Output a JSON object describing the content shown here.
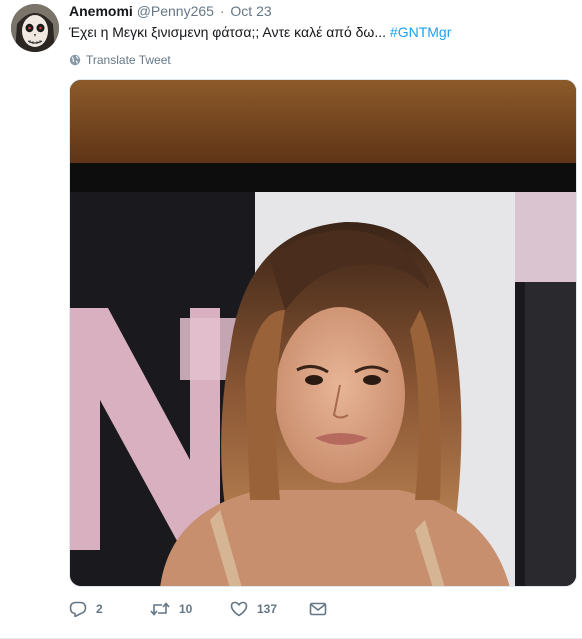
{
  "tweet": {
    "fullname": "Anemomi",
    "username": "@Penny265",
    "separator": "·",
    "time": "Oct 23",
    "text": "Έχει η Μεγκι ξινισμενη φάτσα;; Αντε καλέ από δω...",
    "hashtag": "#GNTMgr",
    "translate_label": "Translate Tweet",
    "reply_count": "2",
    "retweet_count": "10",
    "like_count": "137"
  },
  "icons": {
    "avatar": "skull-face-avatar",
    "translate": "globe-icon",
    "reply": "reply-icon",
    "retweet": "retweet-icon",
    "like": "heart-icon",
    "dm": "envelope-icon"
  },
  "colors": {
    "link": "#1da1f2",
    "muted": "#657786",
    "text": "#14171a"
  }
}
